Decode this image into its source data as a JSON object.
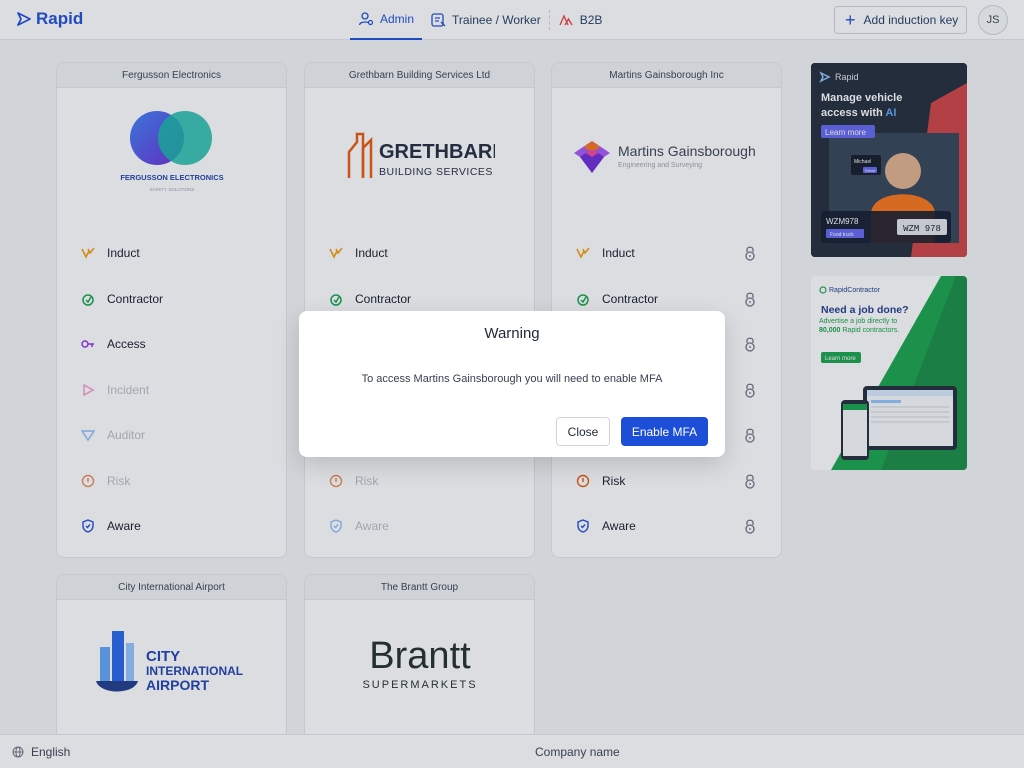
{
  "app": {
    "logo_text": "Rapid"
  },
  "nav": {
    "tabs": [
      {
        "label": "Admin",
        "icon": "user-admin-icon",
        "active": true
      },
      {
        "label": "Trainee / Worker",
        "icon": "clipboard-icon",
        "active": false
      },
      {
        "label": "B2B",
        "icon": "b2b-icon",
        "active": false
      }
    ]
  },
  "header": {
    "add_key_label": "Add induction key",
    "avatar_initials": "JS"
  },
  "modules": {
    "induct": "Induct",
    "contractor": "Contractor",
    "access": "Access",
    "incident": "Incident",
    "auditor": "Auditor",
    "risk": "Risk",
    "aware": "Aware"
  },
  "companies": [
    {
      "name": "Fergusson Electronics",
      "logo_title": "FERGUSSON ELECTRONICS",
      "logo_sub": "SAFETY SOLUTIONS"
    },
    {
      "name": "Grethbarn Building Services Ltd",
      "logo_title": "GRETHBARN",
      "logo_sub": "BUILDING SERVICES"
    },
    {
      "name": "Martins Gainsborough Inc",
      "logo_title": "Martins Gainsborough",
      "logo_sub": "Engineering and Surveying"
    },
    {
      "name": "City International Airport",
      "logo_lines": [
        "CITY",
        "INTERNATIONAL",
        "AIRPORT"
      ]
    },
    {
      "name": "The Brantt Group",
      "logo_title": "Brantt",
      "logo_sub": "SUPERMARKETS"
    }
  ],
  "ads": {
    "ad1": {
      "title_line1": "Manage vehicle",
      "title_line2_prefix": "access with ",
      "title_line2_accent": "AI",
      "cta": "Learn more",
      "name_tag": "Michael",
      "name_sub": "Driver",
      "plate_label": "WZM978",
      "plate_sub": "Food truck",
      "plate": "WZM 978"
    },
    "ad2": {
      "brand": "RapidContractor",
      "headline": "Need a job done?",
      "body_prefix": "Advertise a job directly to ",
      "body_bold": "80,000",
      "body_suffix": " Rapid contractors.",
      "cta": "Learn more"
    }
  },
  "footer": {
    "language": "English",
    "company_label": "Company name"
  },
  "modal": {
    "title": "Warning",
    "message": "To access Martins Gainsborough you will need to enable MFA",
    "close_label": "Close",
    "confirm_label": "Enable MFA"
  },
  "colors": {
    "primary": "#1d4ed8",
    "induct": "#f59e0b",
    "contractor": "#16a34a",
    "access": "#9333ea",
    "incident": "#f472b6",
    "risk": "#ea580c"
  }
}
